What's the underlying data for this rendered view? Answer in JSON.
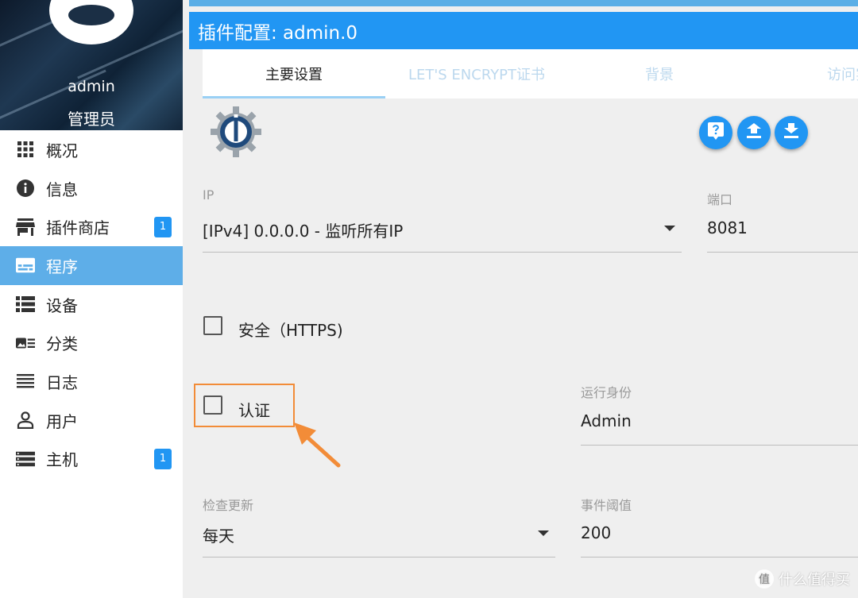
{
  "profile": {
    "username": "admin",
    "role": "管理员"
  },
  "sidebar": {
    "items": [
      {
        "label": "概况",
        "icon": "grid-icon"
      },
      {
        "label": "信息",
        "icon": "info-icon"
      },
      {
        "label": "插件商店",
        "icon": "store-icon",
        "badge": "1"
      },
      {
        "label": "程序",
        "icon": "instances-icon",
        "active": true
      },
      {
        "label": "设备",
        "icon": "devices-icon"
      },
      {
        "label": "分类",
        "icon": "enum-icon"
      },
      {
        "label": "日志",
        "icon": "log-icon"
      },
      {
        "label": "用户",
        "icon": "user-icon"
      },
      {
        "label": "主机",
        "icon": "hosts-icon",
        "badge": "1"
      }
    ]
  },
  "title": "插件配置: admin.0",
  "tabs": [
    {
      "label": "主要设置",
      "active": true
    },
    {
      "label": "LET'S ENCRYPT证书"
    },
    {
      "label": "背景"
    },
    {
      "label": "访问实"
    }
  ],
  "actions": [
    {
      "icon": "help-icon"
    },
    {
      "icon": "upload-icon"
    },
    {
      "icon": "download-icon"
    }
  ],
  "form": {
    "ip": {
      "label": "IP",
      "value": "[IPv4] 0.0.0.0 - 监听所有IP"
    },
    "port": {
      "label": "端口",
      "value": "8081"
    },
    "https": {
      "label": "安全（HTTPS)",
      "checked": false
    },
    "auth": {
      "label": "认证",
      "checked": false
    },
    "run_as": {
      "label": "运行身份",
      "value": "Admin"
    },
    "update_check": {
      "label": "检查更新",
      "value": "每天"
    },
    "event_threshold": {
      "label": "事件阈值",
      "value": "200"
    }
  },
  "watermark": {
    "text": "什么值得买",
    "symbol": "值"
  },
  "colors": {
    "accent": "#2196f3",
    "sidebar_active": "#5eaee8",
    "highlight": "#f28c38"
  }
}
